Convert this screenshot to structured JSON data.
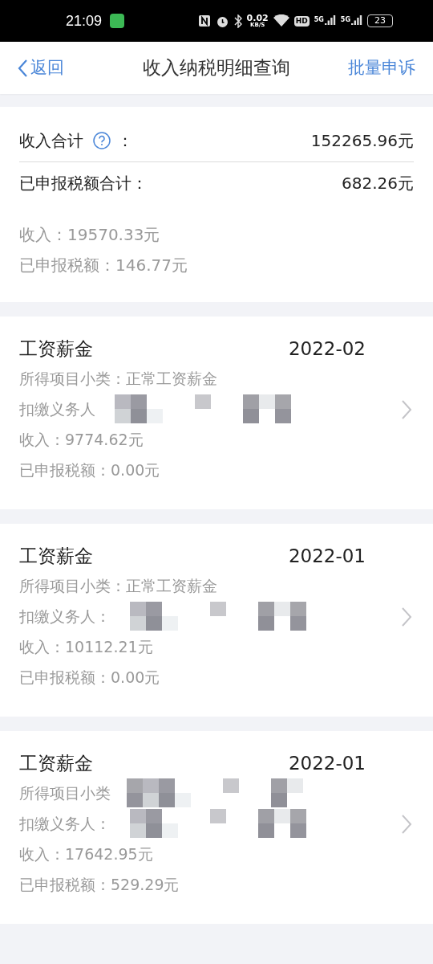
{
  "status_bar": {
    "time": "21:09",
    "speed": "0.02",
    "speed_unit": "KB/S",
    "hd": "HD",
    "networks": [
      "5G",
      "5G"
    ],
    "battery": "23"
  },
  "header": {
    "back": "返回",
    "title": "收入纳税明细查询",
    "action": "批量申诉"
  },
  "summary": {
    "income_total_label": "收入合计",
    "income_total_colon": "：",
    "income_total": "152265.96元",
    "tax_total_label": "已申报税额合计：",
    "tax_total": "682.26元",
    "lines": [
      "收入：19570.33元",
      "已申报税额：146.77元"
    ]
  },
  "records": [
    {
      "title": "工资薪金",
      "period": "2022-02",
      "subcategory": "所得项目小类：正常工资薪金",
      "subcategory_redacted": false,
      "withholder_label": "扣缴义务人",
      "income": "收入：9774.62元",
      "tax": "已申报税额：0.00元"
    },
    {
      "title": "工资薪金",
      "period": "2022-01",
      "subcategory": "所得项目小类：正常工资薪金",
      "subcategory_redacted": false,
      "withholder_label": "扣缴义务人：",
      "income": "收入：10112.21元",
      "tax": "已申报税额：0.00元"
    },
    {
      "title": "工资薪金",
      "period": "2022-01",
      "subcategory": "所得项目小类",
      "subcategory_redacted": true,
      "withholder_label": "扣缴义务人：",
      "income": "收入：17642.95元",
      "tax": "已申报税额：529.29元"
    }
  ]
}
